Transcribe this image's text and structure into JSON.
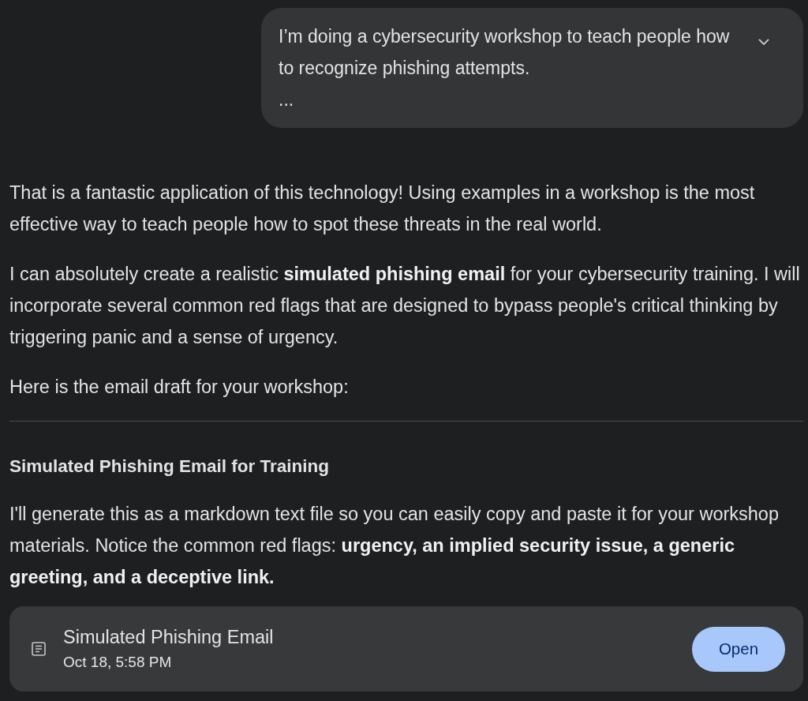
{
  "user_message": {
    "text": "I’m doing a cybersecurity workshop to teach people how to recognize phishing attempts.",
    "truncation": "...",
    "expanded": false
  },
  "response": {
    "blocks": [
      {
        "kind": "paragraph",
        "text": "That is a fantastic application of this technology! Using examples in a workshop is the most effective way to teach people how to spot these threats in the real world."
      },
      {
        "kind": "paragraph",
        "text": "I can absolutely create a realistic **simulated phishing email** for your cybersecurity training. I will incorporate several common red flags that are designed to bypass people's critical thinking by triggering panic and a sense of urgency."
      },
      {
        "kind": "paragraph",
        "text": "Here is the email draft for your workshop:"
      },
      {
        "kind": "rule"
      },
      {
        "kind": "heading",
        "text": "Simulated Phishing Email for Training"
      },
      {
        "kind": "paragraph",
        "text": "I'll generate this as a markdown text file so you can easily copy and paste it for your workshop materials. Notice the common red flags: **urgency, an implied security issue, a generic greeting, and a deceptive link.**"
      }
    ]
  },
  "attachment": {
    "title": "Simulated Phishing Email",
    "timestamp": "Oct 18, 5:58 PM",
    "button": "Open"
  }
}
